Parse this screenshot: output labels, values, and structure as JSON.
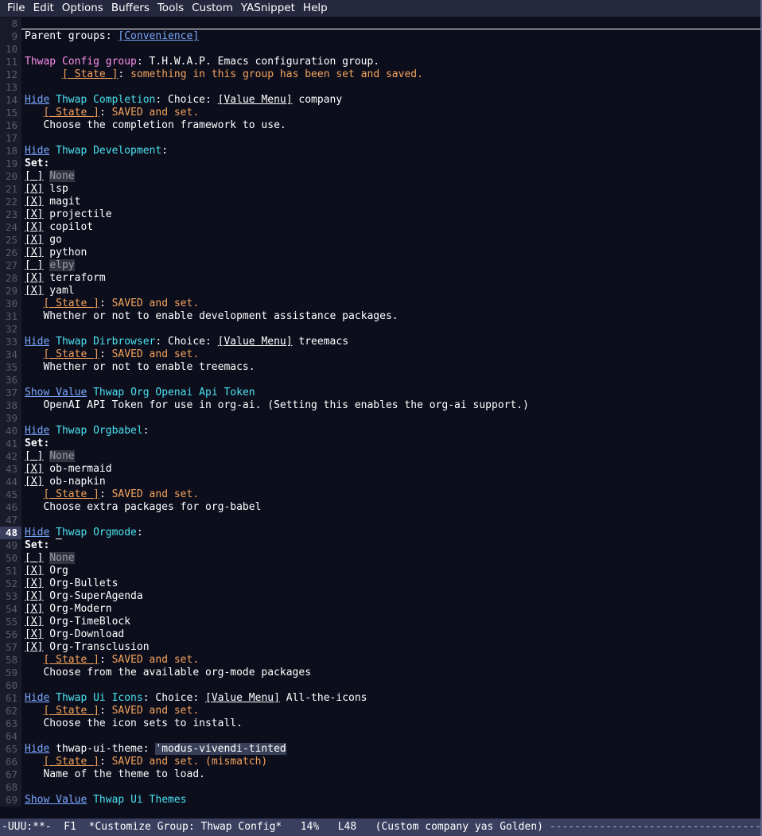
{
  "menubar": {
    "items": [
      "File",
      "Edit",
      "Options",
      "Buffers",
      "Tools",
      "Custom",
      "YASnippet",
      "Help"
    ]
  },
  "colors": {
    "background": "#0d0e1c",
    "foreground": "#ffffff",
    "line_number": "#595a6b",
    "line_number_current_bg": "#3a3f5f",
    "menubar_bg": "#26283f",
    "modeline_bg": "#3a3f5f",
    "link": "#79a8ff",
    "group_name": "#4ae2f0",
    "variable_name": "#6ae4b9",
    "group_title": "#f78fe7",
    "state_value": "#f5a45d",
    "inactive": "#989898",
    "highlight_bg": "#3a3f58"
  },
  "buffer": {
    "first_line_number": 8,
    "cursor_line": 48,
    "lines": [
      {
        "n": 8,
        "type": "rule",
        "segments": []
      },
      {
        "n": 9,
        "segments": [
          {
            "t": "Parent groups",
            "c": "white"
          },
          {
            "t": ": ",
            "c": "white"
          },
          {
            "t": "[Convenience]",
            "c": "link"
          }
        ]
      },
      {
        "n": 10,
        "segments": []
      },
      {
        "n": 11,
        "segments": [
          {
            "t": "Thwap Config group",
            "c": "pink"
          },
          {
            "t": ": T.H.W.A.P. Emacs configuration group.",
            "c": "white"
          }
        ]
      },
      {
        "n": 12,
        "segments": [
          {
            "t": "      ",
            "c": "white"
          },
          {
            "t": "[ State ]",
            "c": "gold",
            "ul": true
          },
          {
            "t": ": ",
            "c": "white"
          },
          {
            "t": "something in this group has been set and saved.",
            "c": "gold"
          }
        ]
      },
      {
        "n": 13,
        "segments": []
      },
      {
        "n": 14,
        "segments": [
          {
            "t": "Hide",
            "c": "link"
          },
          {
            "t": " ",
            "c": "white"
          },
          {
            "t": "Thwap Completion",
            "c": "teal"
          },
          {
            "t": ": Choice: ",
            "c": "white"
          },
          {
            "t": "[Value Menu]",
            "c": "white",
            "ul": true
          },
          {
            "t": " company",
            "c": "white"
          }
        ]
      },
      {
        "n": 15,
        "segments": [
          {
            "t": "   ",
            "c": "white"
          },
          {
            "t": "[ State ]",
            "c": "gold",
            "ul": true
          },
          {
            "t": ": ",
            "c": "white"
          },
          {
            "t": "SAVED and set.",
            "c": "gold"
          }
        ]
      },
      {
        "n": 16,
        "segments": [
          {
            "t": "   Choose the completion framework to use.",
            "c": "white"
          }
        ]
      },
      {
        "n": 17,
        "segments": []
      },
      {
        "n": 18,
        "segments": [
          {
            "t": "Hide",
            "c": "link"
          },
          {
            "t": " ",
            "c": "white"
          },
          {
            "t": "Thwap Development",
            "c": "teal"
          },
          {
            "t": ":",
            "c": "white"
          }
        ]
      },
      {
        "n": 19,
        "segments": [
          {
            "t": "Set:",
            "c": "white",
            "bold": true
          }
        ]
      },
      {
        "n": 20,
        "segments": [
          {
            "t": "[ ]",
            "c": "white",
            "ul": true
          },
          {
            "t": " ",
            "c": "white"
          },
          {
            "t": "None",
            "c": "grey",
            "hl": "dim"
          }
        ]
      },
      {
        "n": 21,
        "segments": [
          {
            "t": "[X]",
            "c": "white",
            "ul": true
          },
          {
            "t": " lsp",
            "c": "white"
          }
        ]
      },
      {
        "n": 22,
        "segments": [
          {
            "t": "[X]",
            "c": "white",
            "ul": true
          },
          {
            "t": " magit",
            "c": "white"
          }
        ]
      },
      {
        "n": 23,
        "segments": [
          {
            "t": "[X]",
            "c": "white",
            "ul": true
          },
          {
            "t": " projectile",
            "c": "white"
          }
        ]
      },
      {
        "n": 24,
        "segments": [
          {
            "t": "[X]",
            "c": "white",
            "ul": true
          },
          {
            "t": " copilot",
            "c": "white"
          }
        ]
      },
      {
        "n": 25,
        "segments": [
          {
            "t": "[X]",
            "c": "white",
            "ul": true
          },
          {
            "t": " go",
            "c": "white"
          }
        ]
      },
      {
        "n": 26,
        "segments": [
          {
            "t": "[X]",
            "c": "white",
            "ul": true
          },
          {
            "t": " python",
            "c": "white"
          }
        ]
      },
      {
        "n": 27,
        "segments": [
          {
            "t": "[ ]",
            "c": "white",
            "ul": true
          },
          {
            "t": " ",
            "c": "white"
          },
          {
            "t": "elpy",
            "c": "grey",
            "hl": "dim"
          }
        ]
      },
      {
        "n": 28,
        "segments": [
          {
            "t": "[X]",
            "c": "white",
            "ul": true
          },
          {
            "t": " terraform",
            "c": "white"
          }
        ]
      },
      {
        "n": 29,
        "segments": [
          {
            "t": "[X]",
            "c": "white",
            "ul": true
          },
          {
            "t": " yaml",
            "c": "white"
          }
        ]
      },
      {
        "n": 30,
        "segments": [
          {
            "t": "   ",
            "c": "white"
          },
          {
            "t": "[ State ]",
            "c": "gold",
            "ul": true
          },
          {
            "t": ": ",
            "c": "white"
          },
          {
            "t": "SAVED and set.",
            "c": "gold"
          }
        ]
      },
      {
        "n": 31,
        "segments": [
          {
            "t": "   Whether or not to enable development assistance packages.",
            "c": "white"
          }
        ]
      },
      {
        "n": 32,
        "segments": []
      },
      {
        "n": 33,
        "segments": [
          {
            "t": "Hide",
            "c": "link"
          },
          {
            "t": " ",
            "c": "white"
          },
          {
            "t": "Thwap Dirbrowser",
            "c": "teal"
          },
          {
            "t": ": Choice: ",
            "c": "white"
          },
          {
            "t": "[Value Menu]",
            "c": "white",
            "ul": true
          },
          {
            "t": " treemacs",
            "c": "white"
          }
        ]
      },
      {
        "n": 34,
        "segments": [
          {
            "t": "   ",
            "c": "white"
          },
          {
            "t": "[ State ]",
            "c": "gold",
            "ul": true
          },
          {
            "t": ": ",
            "c": "white"
          },
          {
            "t": "SAVED and set.",
            "c": "gold"
          }
        ]
      },
      {
        "n": 35,
        "segments": [
          {
            "t": "   Whether or not to enable treemacs.",
            "c": "white"
          }
        ]
      },
      {
        "n": 36,
        "segments": []
      },
      {
        "n": 37,
        "segments": [
          {
            "t": "Show Value",
            "c": "link"
          },
          {
            "t": " ",
            "c": "white"
          },
          {
            "t": "Thwap Org Openai Api Token",
            "c": "teal"
          }
        ]
      },
      {
        "n": 38,
        "segments": [
          {
            "t": "   OpenAI API Token for use in org-ai. (Setting this enables the org-ai support.)",
            "c": "white"
          }
        ]
      },
      {
        "n": 39,
        "segments": []
      },
      {
        "n": 40,
        "segments": [
          {
            "t": "Hide",
            "c": "link"
          },
          {
            "t": " ",
            "c": "white"
          },
          {
            "t": "Thwap Orgbabel",
            "c": "teal"
          },
          {
            "t": ":",
            "c": "white"
          }
        ]
      },
      {
        "n": 41,
        "segments": [
          {
            "t": "Set:",
            "c": "white",
            "bold": true
          }
        ]
      },
      {
        "n": 42,
        "segments": [
          {
            "t": "[ ]",
            "c": "white",
            "ul": true
          },
          {
            "t": " ",
            "c": "white"
          },
          {
            "t": "None",
            "c": "grey",
            "hl": "dim"
          }
        ]
      },
      {
        "n": 43,
        "segments": [
          {
            "t": "[X]",
            "c": "white",
            "ul": true
          },
          {
            "t": " ob-mermaid",
            "c": "white"
          }
        ]
      },
      {
        "n": 44,
        "segments": [
          {
            "t": "[X]",
            "c": "white",
            "ul": true
          },
          {
            "t": " ob-napkin",
            "c": "white"
          }
        ]
      },
      {
        "n": 45,
        "segments": [
          {
            "t": "   ",
            "c": "white"
          },
          {
            "t": "[ State ]",
            "c": "gold",
            "ul": true
          },
          {
            "t": ": ",
            "c": "white"
          },
          {
            "t": "SAVED and set.",
            "c": "gold"
          }
        ]
      },
      {
        "n": 46,
        "segments": [
          {
            "t": "   Choose extra packages for org-babel",
            "c": "white"
          }
        ]
      },
      {
        "n": 47,
        "segments": []
      },
      {
        "n": 48,
        "cursor": true,
        "segments": [
          {
            "t": "Hide",
            "c": "link"
          },
          {
            "t": " ",
            "c": "white"
          },
          {
            "t": "T",
            "c": "teal",
            "cursor": true
          },
          {
            "t": "hwap Orgmode",
            "c": "teal"
          },
          {
            "t": ":",
            "c": "white"
          }
        ]
      },
      {
        "n": 49,
        "segments": [
          {
            "t": "Set:",
            "c": "white",
            "bold": true
          }
        ]
      },
      {
        "n": 50,
        "segments": [
          {
            "t": "[ ]",
            "c": "white",
            "ul": true
          },
          {
            "t": " ",
            "c": "white"
          },
          {
            "t": "None",
            "c": "grey",
            "hl": "dim"
          }
        ]
      },
      {
        "n": 51,
        "segments": [
          {
            "t": "[X]",
            "c": "white",
            "ul": true
          },
          {
            "t": " Org",
            "c": "white"
          }
        ]
      },
      {
        "n": 52,
        "segments": [
          {
            "t": "[X]",
            "c": "white",
            "ul": true
          },
          {
            "t": " Org-Bullets",
            "c": "white"
          }
        ]
      },
      {
        "n": 53,
        "segments": [
          {
            "t": "[X]",
            "c": "white",
            "ul": true
          },
          {
            "t": " Org-SuperAgenda",
            "c": "white"
          }
        ]
      },
      {
        "n": 54,
        "segments": [
          {
            "t": "[X]",
            "c": "white",
            "ul": true
          },
          {
            "t": " Org-Modern",
            "c": "white"
          }
        ]
      },
      {
        "n": 55,
        "segments": [
          {
            "t": "[X]",
            "c": "white",
            "ul": true
          },
          {
            "t": " Org-TimeBlock",
            "c": "white"
          }
        ]
      },
      {
        "n": 56,
        "segments": [
          {
            "t": "[X]",
            "c": "white",
            "ul": true
          },
          {
            "t": " Org-Download",
            "c": "white"
          }
        ]
      },
      {
        "n": 57,
        "segments": [
          {
            "t": "[X]",
            "c": "white",
            "ul": true
          },
          {
            "t": " Org-Transclusion",
            "c": "white"
          }
        ]
      },
      {
        "n": 58,
        "segments": [
          {
            "t": "   ",
            "c": "white"
          },
          {
            "t": "[ State ]",
            "c": "gold",
            "ul": true
          },
          {
            "t": ": ",
            "c": "white"
          },
          {
            "t": "SAVED and set.",
            "c": "gold"
          }
        ]
      },
      {
        "n": 59,
        "segments": [
          {
            "t": "   Choose from the available org-mode packages",
            "c": "white"
          }
        ]
      },
      {
        "n": 60,
        "segments": []
      },
      {
        "n": 61,
        "segments": [
          {
            "t": "Hide",
            "c": "link"
          },
          {
            "t": " ",
            "c": "white"
          },
          {
            "t": "Thwap Ui Icons",
            "c": "teal"
          },
          {
            "t": ": Choice: ",
            "c": "white"
          },
          {
            "t": "[Value Menu]",
            "c": "white",
            "ul": true
          },
          {
            "t": " All-the-icons",
            "c": "white"
          }
        ]
      },
      {
        "n": 62,
        "segments": [
          {
            "t": "   ",
            "c": "white"
          },
          {
            "t": "[ State ]",
            "c": "gold",
            "ul": true
          },
          {
            "t": ": ",
            "c": "white"
          },
          {
            "t": "SAVED and set.",
            "c": "gold"
          }
        ]
      },
      {
        "n": 63,
        "segments": [
          {
            "t": "   Choose the icon sets to install.",
            "c": "white"
          }
        ]
      },
      {
        "n": 64,
        "segments": []
      },
      {
        "n": 65,
        "segments": [
          {
            "t": "Hide",
            "c": "link"
          },
          {
            "t": " ",
            "c": "white"
          },
          {
            "t": "thwap-ui-theme",
            "c": "white"
          },
          {
            "t": ": ",
            "c": "white"
          },
          {
            "t": "'modus-vivendi-tinted",
            "c": "white",
            "hl": "on"
          }
        ]
      },
      {
        "n": 66,
        "segments": [
          {
            "t": "   ",
            "c": "white"
          },
          {
            "t": "[ State ]",
            "c": "gold",
            "ul": true
          },
          {
            "t": ": ",
            "c": "white"
          },
          {
            "t": "SAVED and set. (mismatch)",
            "c": "gold"
          }
        ]
      },
      {
        "n": 67,
        "segments": [
          {
            "t": "   Name of the theme to load.",
            "c": "white"
          }
        ]
      },
      {
        "n": 68,
        "segments": []
      },
      {
        "n": 69,
        "segments": [
          {
            "t": "Show Value",
            "c": "link"
          },
          {
            "t": " ",
            "c": "white"
          },
          {
            "t": "Thwap Ui Themes",
            "c": "teal"
          }
        ]
      }
    ]
  },
  "modeline": {
    "mode_indicator": "-UUU:**-",
    "frame": "F1",
    "buffer_name": "*Customize Group: Thwap Config*",
    "position_percent": "14%",
    "line_indicator": "L48",
    "minor_modes": "(Custom company yas Golden)",
    "trailer": "-------------------------------------------------------"
  }
}
